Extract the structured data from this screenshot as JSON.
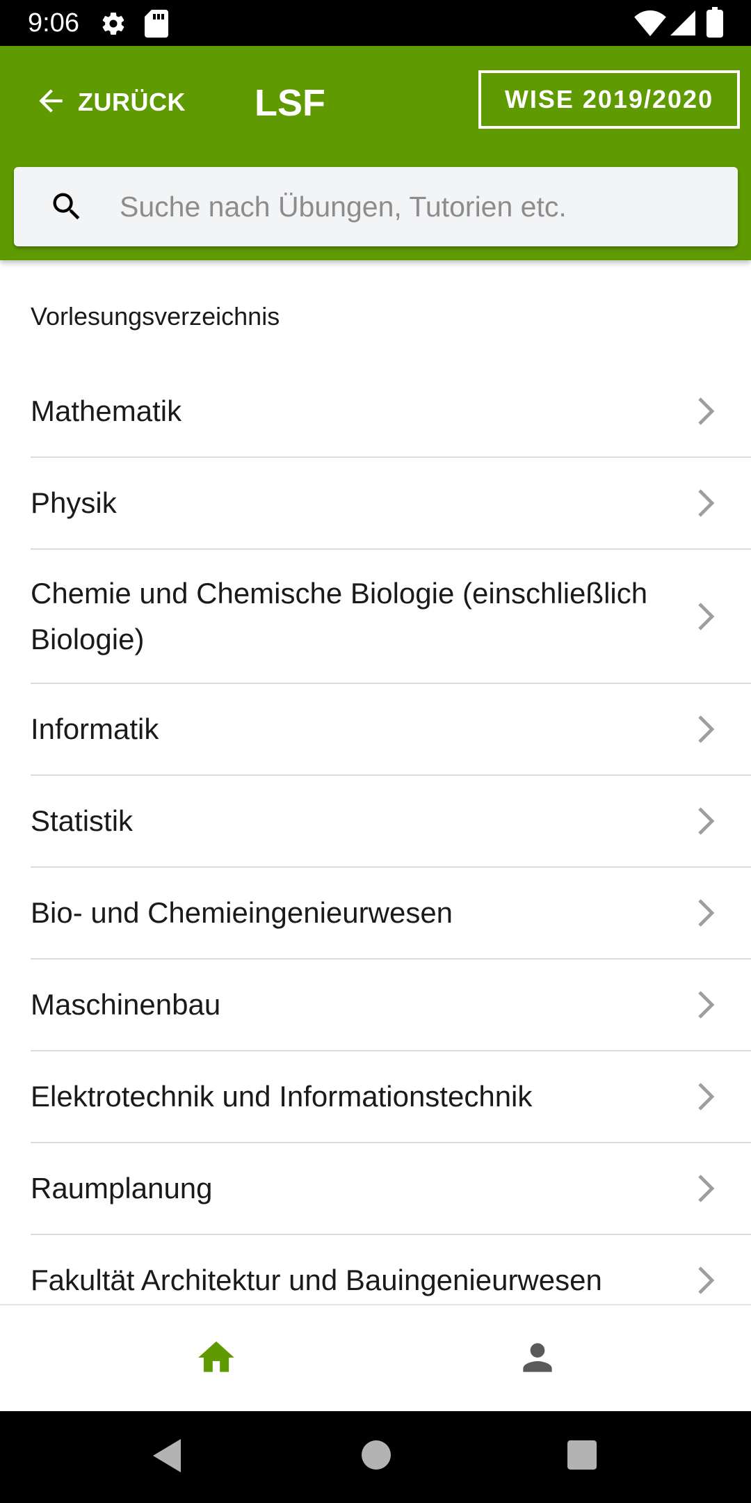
{
  "status_bar": {
    "time": "9:06",
    "icons": [
      "settings-icon",
      "sd-card-icon",
      "wifi-icon",
      "signal-icon",
      "battery-icon"
    ]
  },
  "header": {
    "back_label": "ZURÜCK",
    "title": "LSF",
    "semester_label": "WISE 2019/2020",
    "background_color": "#5f9b00"
  },
  "search": {
    "placeholder": "Suche nach Übungen, Tutorien etc.",
    "value": ""
  },
  "main": {
    "section_title": "Vorlesungsverzeichnis",
    "items": [
      {
        "label": "Mathematik"
      },
      {
        "label": "Physik"
      },
      {
        "label": "Chemie und Chemische Biologie (einschließlich Biologie)"
      },
      {
        "label": "Informatik"
      },
      {
        "label": "Statistik"
      },
      {
        "label": "Bio- und Chemieingenieurwesen"
      },
      {
        "label": "Maschinenbau"
      },
      {
        "label": "Elektrotechnik und Informationstechnik"
      },
      {
        "label": "Raumplanung"
      },
      {
        "label": "Fakultät Architektur und Bauingenieurwesen"
      }
    ]
  },
  "bottom_nav": {
    "items": [
      {
        "icon": "home-icon",
        "active": true,
        "color": "#5f9b00"
      },
      {
        "icon": "person-icon",
        "active": false,
        "color": "#5a5a5a"
      }
    ]
  },
  "system_nav": {
    "buttons": [
      "back-triangle-icon",
      "home-circle-icon",
      "recents-square-icon"
    ]
  }
}
